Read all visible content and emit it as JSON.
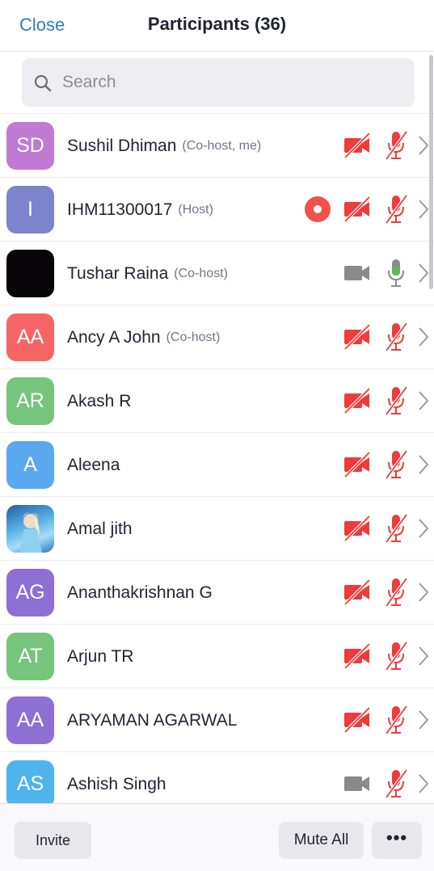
{
  "header": {
    "close_label": "Close",
    "title": "Participants (36)"
  },
  "search": {
    "placeholder": "Search"
  },
  "participants": [
    {
      "initials": "SD",
      "name": "Sushil Dhiman",
      "role": "(Co-host, me)",
      "avatar_color": "#c07ad4",
      "video": "off",
      "audio": "muted",
      "recording": false
    },
    {
      "initials": "I",
      "name": "IHM11300017",
      "role": "(Host)",
      "avatar_color": "#7b84cc",
      "video": "off",
      "audio": "muted",
      "recording": true
    },
    {
      "initials": "",
      "name": "Tushar Raina",
      "role": "(Co-host)",
      "avatar_color": "#0a0508",
      "video": "inactive",
      "audio": "unmuted",
      "recording": false
    },
    {
      "initials": "AA",
      "name": "Ancy A John",
      "role": "(Co-host)",
      "avatar_color": "#f56565",
      "video": "off",
      "audio": "muted",
      "recording": false
    },
    {
      "initials": "AR",
      "name": "Akash R",
      "role": "",
      "avatar_color": "#77c47c",
      "video": "off",
      "audio": "muted",
      "recording": false
    },
    {
      "initials": "A",
      "name": "Aleena",
      "role": "",
      "avatar_color": "#5aa9f0",
      "video": "off",
      "audio": "muted",
      "recording": false
    },
    {
      "initials": "",
      "name": "Amal jith",
      "role": "",
      "avatar_color": "#3b8fd0",
      "video": "off",
      "audio": "muted",
      "recording": false
    },
    {
      "initials": "AG",
      "name": "Ananthakrishnan G",
      "role": "",
      "avatar_color": "#8e6fd4",
      "video": "off",
      "audio": "muted",
      "recording": false
    },
    {
      "initials": "AT",
      "name": "Arjun TR",
      "role": "",
      "avatar_color": "#77c47c",
      "video": "off",
      "audio": "muted",
      "recording": false
    },
    {
      "initials": "AA",
      "name": "ARYAMAN AGARWAL",
      "role": "",
      "avatar_color": "#8e6fd4",
      "video": "off",
      "audio": "muted",
      "recording": false
    },
    {
      "initials": "AS",
      "name": "Ashish Singh",
      "role": "",
      "avatar_color": "#4fb3ec",
      "video": "inactive",
      "audio": "muted",
      "recording": false
    }
  ],
  "footer": {
    "invite_label": "Invite",
    "mute_all_label": "Mute All",
    "more_label": "•••"
  },
  "colors": {
    "accent": "#2d7cc4",
    "muted_red": "#ee3b3b",
    "mic_on_green": "#5cb85c",
    "inactive_gray": "#8a8a8a"
  }
}
